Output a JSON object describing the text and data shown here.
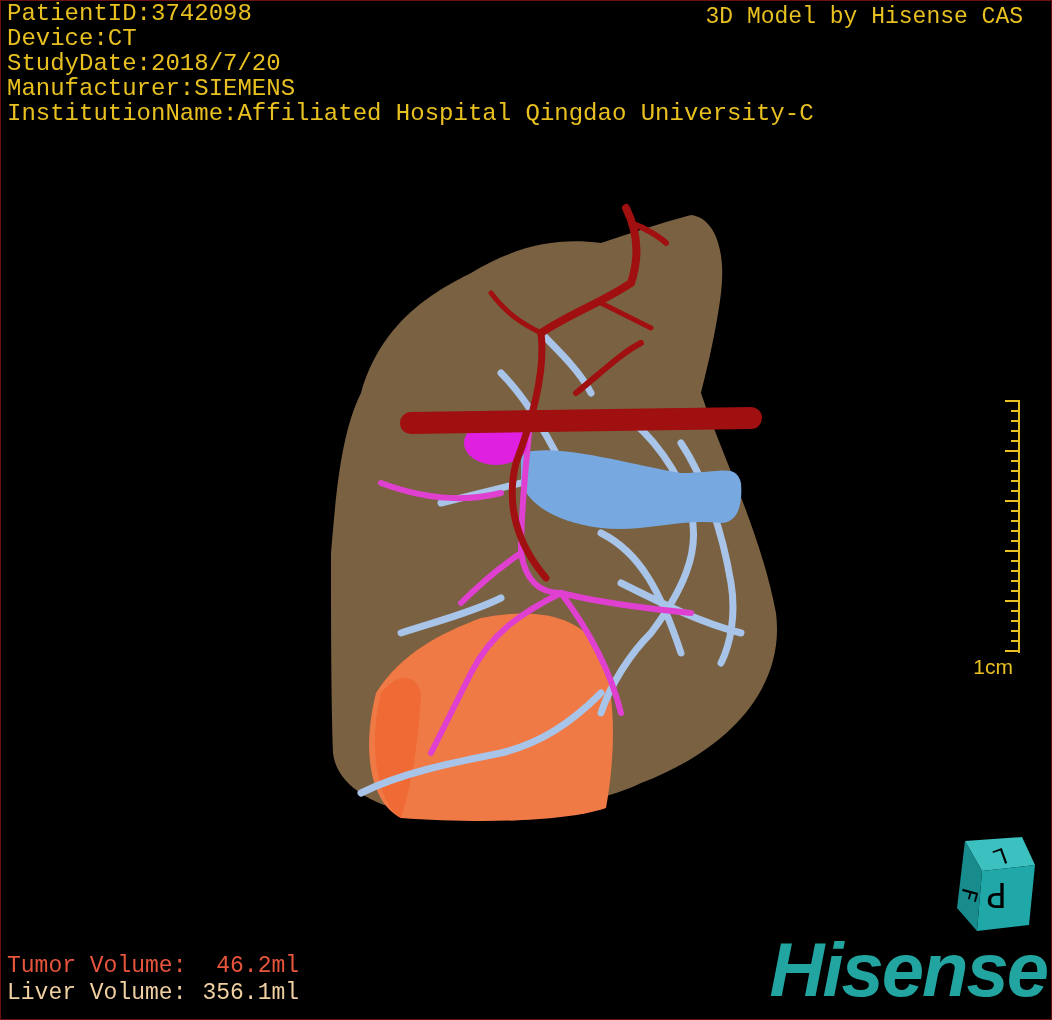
{
  "info_lines": [
    "PatientID:3742098",
    "Device:CT",
    "StudyDate:2018/7/20",
    "Manufacturer:SIEMENS",
    "InstitutionName:Affiliated Hospital Qingdao University-C"
  ],
  "title": "3D Model by Hisense CAS",
  "scale_bar": {
    "label": "1cm"
  },
  "volumes": [
    {
      "label": "Tumor Volume:",
      "value": "46.2ml",
      "color": "#e8553d"
    },
    {
      "label": "Liver Volume:",
      "value": "356.1ml",
      "color": "#f0d0a0"
    }
  ],
  "orientation_cube": {
    "faces": [
      "L",
      "P",
      "F"
    ]
  },
  "logo": "Hisense"
}
